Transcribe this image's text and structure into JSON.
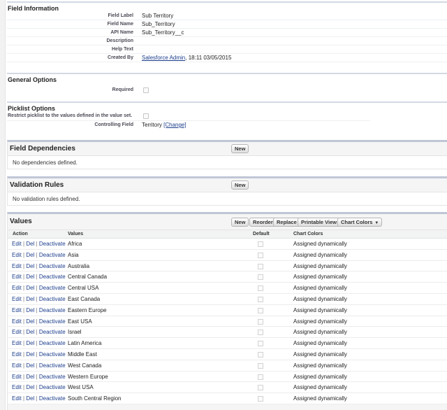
{
  "field_information": {
    "title": "Field Information",
    "rows": [
      {
        "label": "Field Label",
        "value": "Sub Territory"
      },
      {
        "label": "Field Name",
        "value": "Sub_Territory"
      },
      {
        "label": "API Name",
        "value": "Sub_Territory__c"
      },
      {
        "label": "Description",
        "value": ""
      },
      {
        "label": "Help Text",
        "value": ""
      }
    ],
    "created_by": {
      "label": "Created By",
      "user": "Salesforce Admin",
      "timestamp": ", 18:11 03/05/2015"
    }
  },
  "general_options": {
    "title": "General Options",
    "required_label": "Required"
  },
  "picklist_options": {
    "title": "Picklist Options",
    "restrict_label": "Restrict picklist to the values defined in the value set.",
    "controlling_label": "Controlling Field",
    "controlling_value": "Territory",
    "change_link": "[Change]"
  },
  "field_dependencies": {
    "title": "Field Dependencies",
    "new_button": "New",
    "empty_text": "No dependencies defined."
  },
  "validation_rules": {
    "title": "Validation Rules",
    "new_button": "New",
    "empty_text": "No validation rules defined."
  },
  "values": {
    "title": "Values",
    "buttons": {
      "new": "New",
      "reorder": "Reorder",
      "replace": "Replace",
      "printable": "Printable View",
      "chart_colors": "Chart Colors"
    },
    "columns": {
      "action": "Action",
      "values": "Values",
      "default": "Default",
      "chart_colors": "Chart Colors"
    },
    "action_links": {
      "edit": "Edit",
      "del": "Del",
      "deactivate": "Deactivate",
      "sep": " | "
    },
    "rows": [
      {
        "value": "Africa",
        "color": "Assigned dynamically"
      },
      {
        "value": "Asia",
        "color": "Assigned dynamically"
      },
      {
        "value": "Australia",
        "color": "Assigned dynamically"
      },
      {
        "value": "Central Canada",
        "color": "Assigned dynamically"
      },
      {
        "value": "Central USA",
        "color": "Assigned dynamically"
      },
      {
        "value": "East Canada",
        "color": "Assigned dynamically"
      },
      {
        "value": "Eastern Europe",
        "color": "Assigned dynamically"
      },
      {
        "value": "East USA",
        "color": "Assigned dynamically"
      },
      {
        "value": "Israel",
        "color": "Assigned dynamically"
      },
      {
        "value": "Latin America",
        "color": "Assigned dynamically"
      },
      {
        "value": "Middle East",
        "color": "Assigned dynamically"
      },
      {
        "value": "West Canada",
        "color": "Assigned dynamically"
      },
      {
        "value": "Western Europe",
        "color": "Assigned dynamically"
      },
      {
        "value": "West USA",
        "color": "Assigned dynamically"
      },
      {
        "value": "South Central Region",
        "color": "Assigned dynamically"
      }
    ]
  },
  "colors": {
    "link": "#1c3e8c",
    "section_border": "#d3d9e3",
    "block_border": "#bfc7d6"
  }
}
